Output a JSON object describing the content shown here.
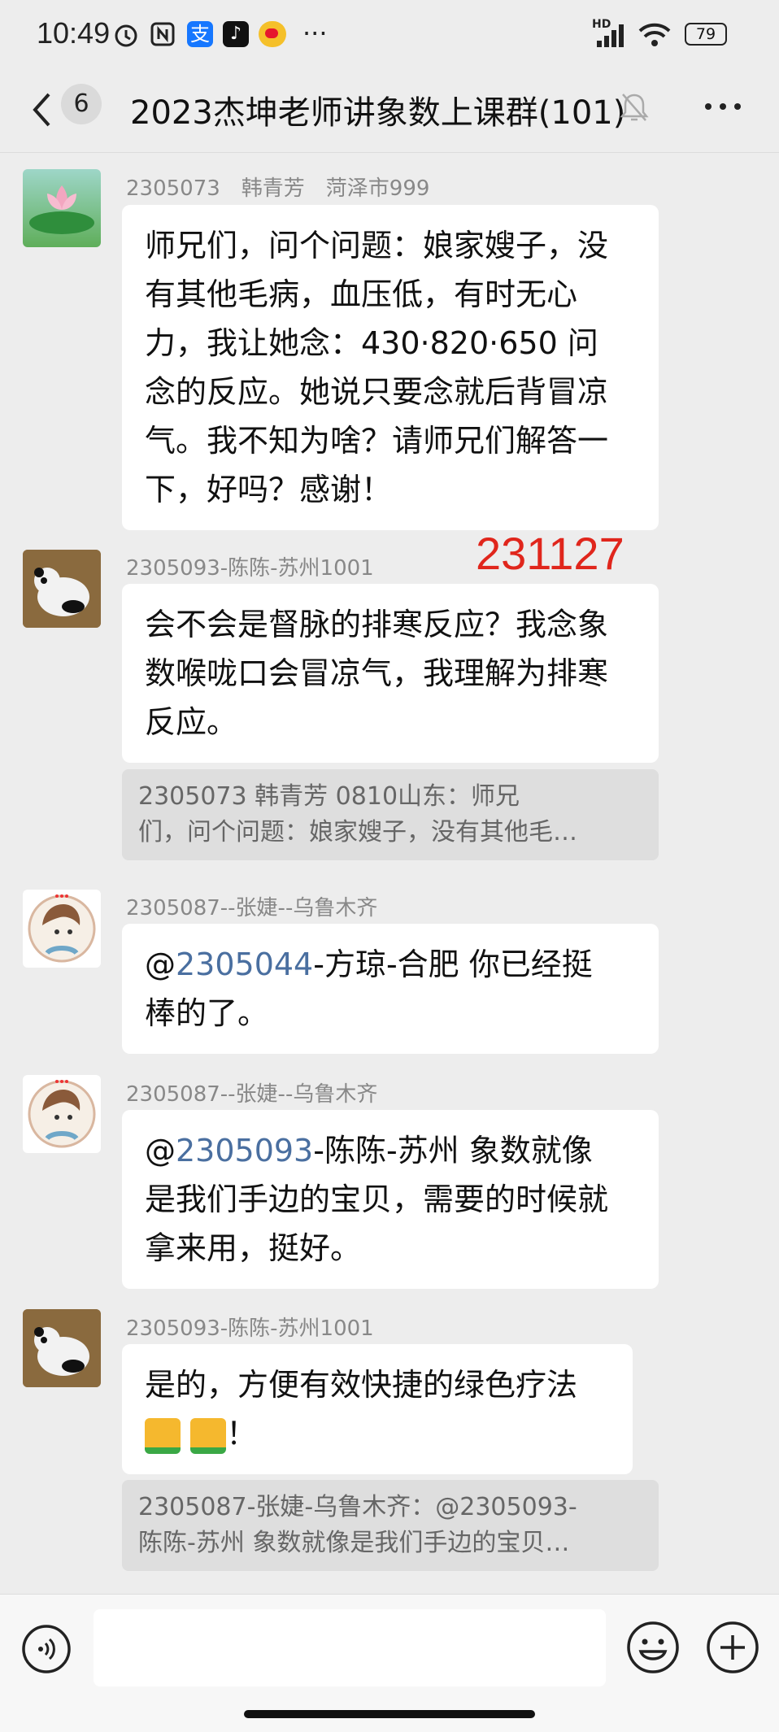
{
  "status": {
    "time": "10:49",
    "network": "HD",
    "battery": "79",
    "more": "···"
  },
  "nav": {
    "unread": "6",
    "title": "2023杰坤老师讲象数上课群(101)"
  },
  "stamp": "231127",
  "messages": [
    {
      "sender": "2305073　韩青芳　菏泽市999",
      "lines": [
        "师兄们，问个问题：娘家嫂子，没",
        "有其他毛病，血压低，有时无心",
        "力，我让她念：430·820·650 问",
        "念的反应。她说只要念就后背冒凉",
        "气。我不知为啥？请师兄们解答一",
        "下，好吗？感谢！"
      ]
    },
    {
      "sender": "2305093-陈陈-苏州1001",
      "lines": [
        "会不会是督脉的排寒反应？我念象",
        "数喉咙口会冒凉气，我理解为排寒",
        "反应。"
      ],
      "quote": [
        "2305073 韩青芳  0810山东：师兄",
        "们，问个问题：娘家嫂子，没有其他毛…"
      ]
    },
    {
      "sender": "2305087--张婕--乌鲁木齐",
      "mention": "2305044",
      "line1_rest": "-方琼-合肥  你已经挺",
      "line2": "棒的了。"
    },
    {
      "sender": "2305087--张婕--乌鲁木齐",
      "mention": "2305093",
      "line1_rest": "-陈陈-苏州  象数就像",
      "lines": [
        "是我们手边的宝贝，需要的时候就",
        "拿来用，挺好。"
      ]
    },
    {
      "sender": "2305093-陈陈-苏州1001",
      "line1": "是的，方便有效快捷的绿色疗法",
      "line2_tail": "！",
      "quote": [
        "2305087-张婕-乌鲁木齐：@2305093-",
        "陈陈-苏州 象数就像是我们手边的宝贝…"
      ]
    }
  ]
}
